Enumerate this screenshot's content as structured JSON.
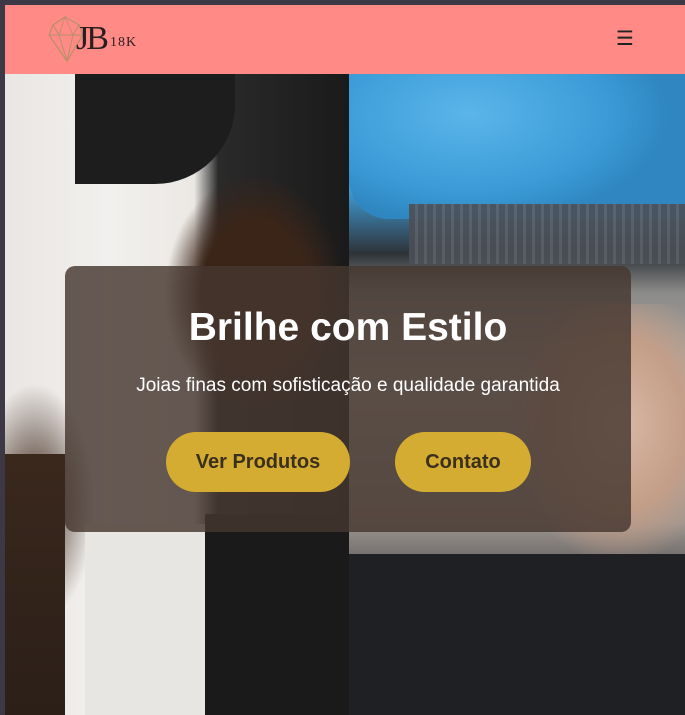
{
  "header": {
    "logo_text": "JB",
    "logo_suffix": "18K",
    "menu_icon": "☰"
  },
  "hero": {
    "title": "Brilhe com Estilo",
    "subtitle": "Joias finas com sofisticação e qualidade garantida",
    "buttons": {
      "products_label": "Ver Produtos",
      "contact_label": "Contato"
    }
  },
  "colors": {
    "header_bg": "#ff8a86",
    "button_bg": "#d4ac31",
    "card_bg": "rgba(70,55,48,0.82)"
  },
  "icons": [
    "diamond-icon",
    "hamburger-menu-icon"
  ]
}
